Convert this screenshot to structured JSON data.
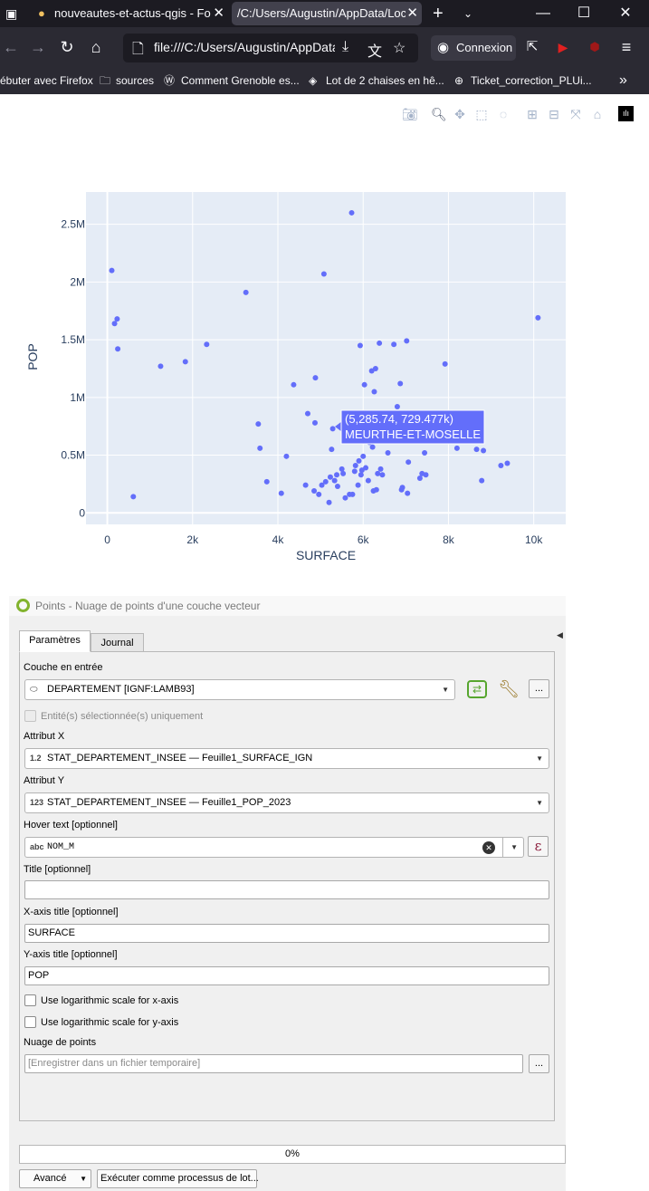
{
  "browser": {
    "tabs": [
      {
        "title": "nouveautes-et-actus-qgis - Fo",
        "active": false
      },
      {
        "title": "/C:/Users/Augustin/AppData/Local",
        "active": true
      }
    ],
    "new_tab": "+",
    "url": "file:///C:/Users/Augustin/AppData/",
    "connexion_label": "Connexion",
    "bookmarks": [
      "ébuter avec Firefox",
      "sources",
      "Comment Grenoble es...",
      "Lot de 2 chaises en hê...",
      "Ticket_correction_PLUi..."
    ],
    "overflow": "»"
  },
  "plot": {
    "modebar_icons": [
      "camera-icon",
      "zoom-icon",
      "pan-icon",
      "select-box-icon",
      "lasso-icon",
      "zoom-in-icon",
      "zoom-out-icon",
      "autoscale-icon",
      "home-icon",
      "plotly-logo-icon"
    ],
    "hover": {
      "line1": "(5,285.74, 729.477k)",
      "line2": "MEURTHE-ET-MOSELLE",
      "color": "#636efa"
    }
  },
  "chart_data": {
    "type": "scatter",
    "title": "",
    "xlabel": "SURFACE",
    "ylabel": "POP",
    "xlim": [
      -500,
      10750
    ],
    "ylim": [
      -100000,
      2780000
    ],
    "x_ticks": [
      {
        "v": 0,
        "label": "0"
      },
      {
        "v": 2000,
        "label": "2k"
      },
      {
        "v": 4000,
        "label": "4k"
      },
      {
        "v": 6000,
        "label": "6k"
      },
      {
        "v": 8000,
        "label": "8k"
      },
      {
        "v": 10000,
        "label": "10k"
      }
    ],
    "y_ticks": [
      {
        "v": 0,
        "label": "0"
      },
      {
        "v": 500000,
        "label": "0.5M"
      },
      {
        "v": 1000000,
        "label": "1M"
      },
      {
        "v": 1500000,
        "label": "1.5M"
      },
      {
        "v": 2000000,
        "label": "2M"
      },
      {
        "v": 2500000,
        "label": "2.5M"
      }
    ],
    "grid": true,
    "marker_color": "#636efa",
    "points": [
      [
        105,
        2100000
      ],
      [
        170,
        1640000
      ],
      [
        230,
        1680000
      ],
      [
        245,
        1420000
      ],
      [
        610,
        140000
      ],
      [
        1250,
        1270000
      ],
      [
        1830,
        1310000
      ],
      [
        2330,
        1460000
      ],
      [
        3250,
        1910000
      ],
      [
        3540,
        770000
      ],
      [
        3580,
        560000
      ],
      [
        3740,
        270000
      ],
      [
        4080,
        170000
      ],
      [
        4200,
        490000
      ],
      [
        4370,
        1110000
      ],
      [
        4650,
        240000
      ],
      [
        4700,
        860000
      ],
      [
        4850,
        190000
      ],
      [
        4870,
        780000
      ],
      [
        4880,
        1170000
      ],
      [
        4960,
        160000
      ],
      [
        5030,
        240000
      ],
      [
        5080,
        2070000
      ],
      [
        5120,
        270000
      ],
      [
        5200,
        90000
      ],
      [
        5230,
        310000
      ],
      [
        5260,
        550000
      ],
      [
        5286,
        729000
      ],
      [
        5330,
        280000
      ],
      [
        5380,
        330000
      ],
      [
        5400,
        230000
      ],
      [
        5500,
        380000
      ],
      [
        5530,
        340000
      ],
      [
        5560,
        630000
      ],
      [
        5580,
        130000
      ],
      [
        5680,
        160000
      ],
      [
        5730,
        2600000
      ],
      [
        5750,
        160000
      ],
      [
        5800,
        360000
      ],
      [
        5820,
        410000
      ],
      [
        5840,
        700000
      ],
      [
        5880,
        240000
      ],
      [
        5900,
        450000
      ],
      [
        5930,
        1450000
      ],
      [
        5950,
        330000
      ],
      [
        5970,
        370000
      ],
      [
        6000,
        490000
      ],
      [
        6030,
        1110000
      ],
      [
        6060,
        390000
      ],
      [
        6080,
        810000
      ],
      [
        6120,
        280000
      ],
      [
        6150,
        610000
      ],
      [
        6200,
        1230000
      ],
      [
        6220,
        570000
      ],
      [
        6240,
        190000
      ],
      [
        6260,
        1050000
      ],
      [
        6290,
        1250000
      ],
      [
        6310,
        200000
      ],
      [
        6340,
        340000
      ],
      [
        6380,
        1470000
      ],
      [
        6410,
        380000
      ],
      [
        6450,
        330000
      ],
      [
        6580,
        520000
      ],
      [
        6720,
        1460000
      ],
      [
        6800,
        920000
      ],
      [
        6870,
        1120000
      ],
      [
        6900,
        200000
      ],
      [
        6920,
        220000
      ],
      [
        7020,
        1490000
      ],
      [
        7040,
        170000
      ],
      [
        7060,
        440000
      ],
      [
        7330,
        300000
      ],
      [
        7380,
        340000
      ],
      [
        7440,
        520000
      ],
      [
        7470,
        330000
      ],
      [
        7920,
        1290000
      ],
      [
        8200,
        560000
      ],
      [
        8660,
        550000
      ],
      [
        8780,
        280000
      ],
      [
        8820,
        540000
      ],
      [
        9230,
        410000
      ],
      [
        9380,
        430000
      ],
      [
        10100,
        1690000
      ]
    ]
  },
  "qgis": {
    "title": "Points - Nuage de points d'une couche vecteur",
    "tabs": [
      "Paramètres",
      "Journal"
    ],
    "input_layer_label": "Couche en entrée",
    "input_layer_value": "DEPARTEMENT [IGNF:LAMB93]",
    "selected_only_label": "Entité(s) sélectionnée(s) uniquement",
    "attr_x_label": "Attribut X",
    "attr_x_type": "1.2",
    "attr_x_value": "STAT_DEPARTEMENT_INSEE — Feuille1_SURFACE_IGN",
    "attr_y_label": "Attribut Y",
    "attr_y_type": "123",
    "attr_y_value": "STAT_DEPARTEMENT_INSEE — Feuille1_POP_2023",
    "hover_label": "Hover text [optionnel]",
    "hover_type": "abc",
    "hover_value": "NOM_M",
    "title_label": "Title [optionnel]",
    "title_value": "",
    "xtitle_label": "X-axis title [optionnel]",
    "xtitle_value": "SURFACE",
    "ytitle_label": "Y-axis title [optionnel]",
    "ytitle_value": "POP",
    "logx_label": "Use logarithmic scale for x-axis",
    "logy_label": "Use logarithmic scale for y-axis",
    "output_label": "Nuage de points",
    "output_placeholder": "[Enregistrer dans un fichier temporaire]",
    "ellipsis": "...",
    "expression_symbol": "ε",
    "progress": "0%",
    "advanced_label": "Avancé",
    "batch_label": "Exécuter comme processus de lot..."
  }
}
